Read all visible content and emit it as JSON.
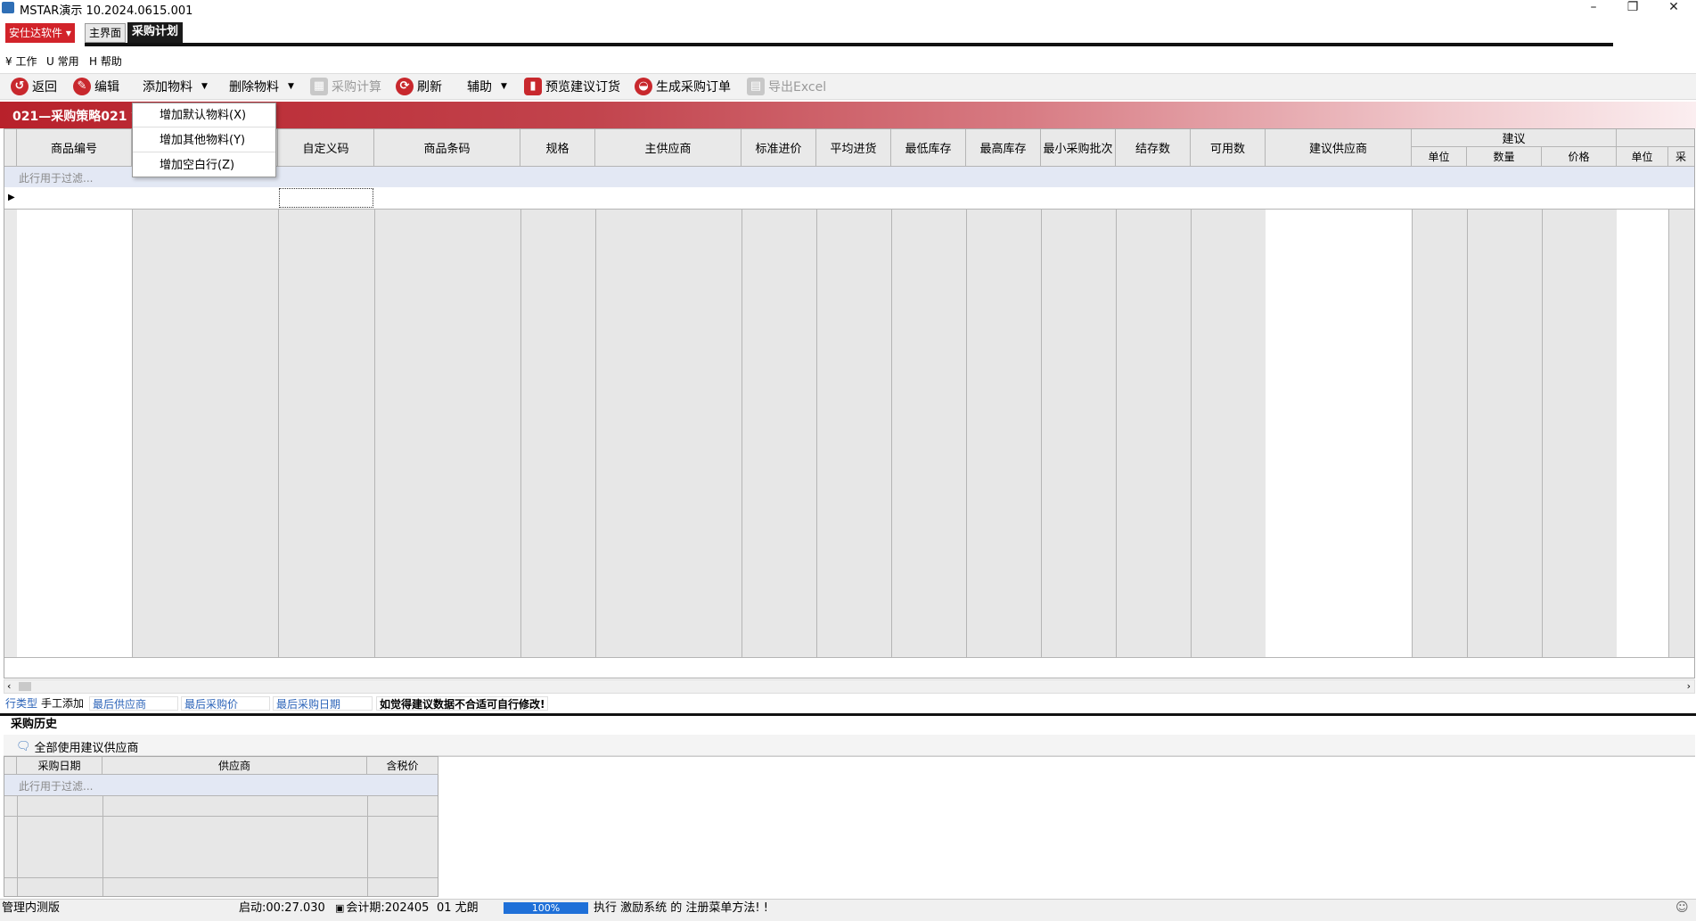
{
  "window": {
    "title": "MSTAR演示   10.2024.0615.001",
    "minimize": "–",
    "restore": "❐",
    "close": "✕"
  },
  "tabs": {
    "brand": "安仕达软件 ▾",
    "main": "主界面",
    "active": "采购计划"
  },
  "menu": {
    "work": "¥ 工作",
    "common": "U 常用",
    "help": "H 帮助"
  },
  "toolbar": {
    "back": "返回",
    "edit": "编辑",
    "add_material": "添加物料",
    "delete_material": "删除物料",
    "calculate": "采购计算",
    "refresh": "刷新",
    "assist": "辅助",
    "preview": "预览建议订货",
    "generate": "生成采购订单",
    "export": "导出Excel"
  },
  "dropdown": {
    "items": [
      "增加默认物料(X)",
      "增加其他物料(Y)",
      "增加空白行(Z)"
    ]
  },
  "band": {
    "title": "021—采购策略021  第"
  },
  "grid": {
    "columns": [
      "商品编号",
      "",
      "自定义码",
      "商品条码",
      "规格",
      "主供应商",
      "标准进价",
      "平均进货",
      "最低库存",
      "最高库存",
      "最小采购批次",
      "结存数",
      "可用数",
      "建议供应商"
    ],
    "group_header": "建议",
    "sub_columns": [
      "单位",
      "数量",
      "价格",
      "单位",
      "采"
    ],
    "filter_placeholder": "此行用于过滤..."
  },
  "info": {
    "row_type_label": "行类型",
    "row_type_value": "手工添加",
    "last_supplier": "最后供应商",
    "last_price": "最后采购价",
    "last_date": "最后采购日期",
    "notice": "如觉得建议数据不合适可自行修改!"
  },
  "history": {
    "tab": "采购历史",
    "use_all": "全部使用建议供应商",
    "columns": [
      "采购日期",
      "供应商",
      "含税价"
    ],
    "filter_placeholder": "此行用于过滤..."
  },
  "status": {
    "left": "管理内测版",
    "startup": "启动:00:27.030",
    "period": "会计期:202405",
    "user": "01 尤朗",
    "progress": "100%",
    "message": "执行 激励系统 的 注册菜单方法! !"
  },
  "colors": {
    "brand": "#d2232a",
    "accent_icon": "#c8282d",
    "progress": "#1f70d8"
  }
}
